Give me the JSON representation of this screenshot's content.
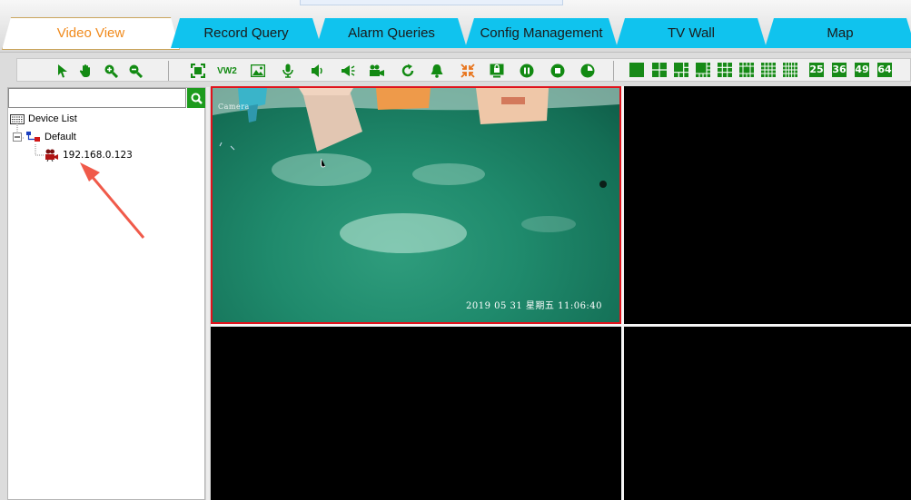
{
  "tabs": [
    {
      "label": "Video View",
      "active": true
    },
    {
      "label": "Record Query",
      "active": false
    },
    {
      "label": "Alarm Queries",
      "active": false
    },
    {
      "label": "Config Management",
      "active": false
    },
    {
      "label": "TV Wall",
      "active": false
    },
    {
      "label": "Map",
      "active": false
    }
  ],
  "toolbar": {
    "icons": [
      "pointer-icon",
      "hand-icon",
      "zoom-in-icon",
      "zoom-out-icon",
      "fullscreen-icon",
      "vw2-icon",
      "snapshot-icon",
      "microphone-icon",
      "speaker-icon",
      "broadcast-icon",
      "record-icon",
      "refresh-icon",
      "alarm-bell-icon",
      "shrink-icon",
      "lock-screen-icon",
      "pause-icon",
      "stop-icon",
      "play-icon"
    ],
    "vw2_label": "VW2",
    "layouts": [
      "1",
      "4",
      "6",
      "8",
      "9",
      "13",
      "16",
      "25",
      "36",
      "49",
      "64"
    ]
  },
  "search": {
    "placeholder": "",
    "value": ""
  },
  "tree": {
    "root": "Device List",
    "group": "Default",
    "device": "192.168.0.123"
  },
  "video": {
    "camera_label": "Camera",
    "timestamp": "2019  05  31   星期五    11:06:40"
  },
  "colors": {
    "accent": "#f08a1c",
    "tab_bg": "#10c3ee",
    "toolbar_green": "#128a12",
    "selected_border": "#e0131c"
  }
}
